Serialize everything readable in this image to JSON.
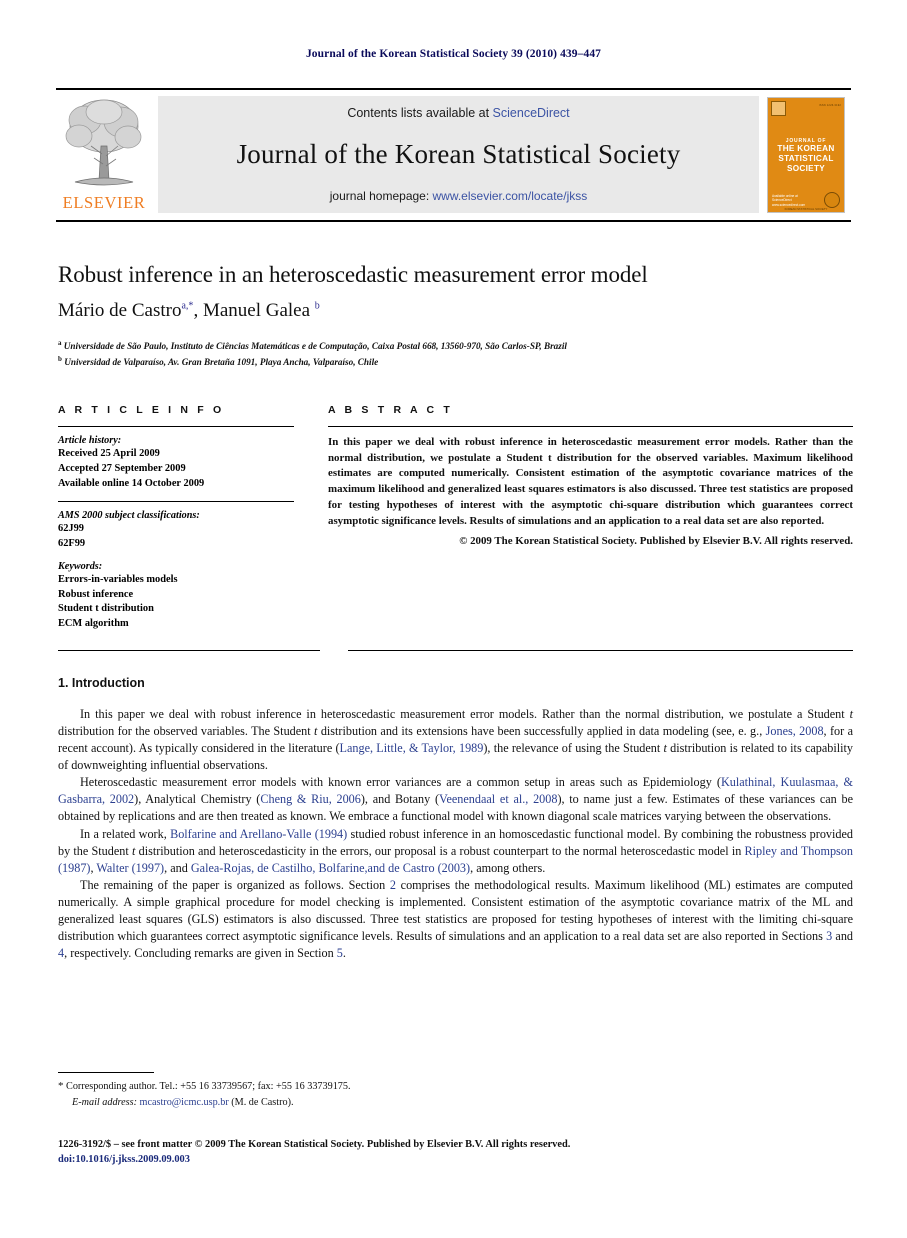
{
  "running_head": "Journal of the Korean Statistical Society 39 (2010) 439–447",
  "masthead": {
    "contents_prefix": "Contents lists available at ",
    "sciencedirect": "ScienceDirect",
    "journal_title": "Journal of the Korean Statistical Society",
    "homepage_prefix": "journal homepage: ",
    "homepage_url": "www.elsevier.com/locate/jkss",
    "publisher_logo_word": "ELSEVIER",
    "cover": {
      "line1": "JOURNAL OF",
      "line2": "THE KOREAN",
      "line3": "STATISTICAL",
      "line4": "SOCIETY",
      "availability": "Available online at",
      "platform": "ScienceDirect",
      "platform_url": "www.sciencedirect.com",
      "society_line": "KOREAN STATISTICAL SOCIETY",
      "top_left_label": "ISSN 1226-3192",
      "top_right_label": "ISSN 1226-3192"
    },
    "accent_color": "#ef7d22",
    "link_color": "#3b53a4",
    "cover_color": "#e08a14"
  },
  "article": {
    "title": "Robust inference in an heteroscedastic measurement error model",
    "authors_part1": "Mário de Castro",
    "authors_sup1": "a,*",
    "authors_part2": ", Manuel Galea ",
    "authors_sup2": "b",
    "affiliation_a_sup": "a",
    "affiliation_a": "Universidade de São Paulo, Instituto de Ciências Matemáticas e de Computação, Caixa Postal 668, 13560-970, São Carlos-SP, Brazil",
    "affiliation_b_sup": "b",
    "affiliation_b": "Universidad de Valparaíso, Av. Gran Bretaña 1091, Playa Ancha, Valparaíso, Chile"
  },
  "article_info": {
    "heading": "A R T I C L E    I N F O",
    "history_label": "Article history:",
    "history": [
      "Received 25 April 2009",
      "Accepted 27 September 2009",
      "Available online 14 October 2009"
    ],
    "ams_label": "AMS 2000 subject classifications:",
    "ams": [
      "62J99",
      "62F99"
    ],
    "keywords_label": "Keywords:",
    "keywords": [
      "Errors-in-variables models",
      "Robust inference",
      "Student t distribution",
      "ECM algorithm"
    ]
  },
  "abstract": {
    "heading": "A B S T R A C T",
    "text": "In this paper we deal with robust inference in heteroscedastic measurement error models. Rather than the normal distribution, we postulate a Student t distribution for the observed variables. Maximum likelihood estimates are computed numerically. Consistent estimation of the asymptotic covariance matrices of the maximum likelihood and generalized least squares estimators is also discussed. Three test statistics are proposed for testing hypotheses of interest with the asymptotic chi-square distribution which guarantees correct asymptotic significance levels. Results of simulations and an application to a real data set are also reported.",
    "copyright": "© 2009 The Korean Statistical Society. Published by Elsevier B.V. All rights reserved."
  },
  "introduction": {
    "heading": "1. Introduction",
    "p1_a": "In this paper we deal with robust inference in heteroscedastic measurement error models. Rather than the normal distribution, we postulate a Student ",
    "p1_b": " distribution for the observed variables. The Student ",
    "p1_c": " distribution and its extensions have been successfully applied in data modeling (see, e. g., ",
    "p1_cite1": "Jones, 2008",
    "p1_d": ", for a recent account). As typically considered in the literature (",
    "p1_cite2": "Lange, Little, & Taylor, 1989",
    "p1_e": "), the relevance of using the Student ",
    "p1_f": " distribution is related to its capability of downweighting influential observations.",
    "p2_a": "Heteroscedastic measurement error models with known error variances are a common setup in areas such as Epidemiology (",
    "p2_cite1": "Kulathinal, Kuulasmaa, & Gasbarra, 2002",
    "p2_b": "), Analytical Chemistry (",
    "p2_cite2": "Cheng & Riu, 2006",
    "p2_c": "), and Botany (",
    "p2_cite3": "Veenendaal et al., 2008",
    "p2_d": "), to name just a few. Estimates of these variances can be obtained by replications and are then treated as known. We embrace a functional model with known diagonal scale matrices varying between the observations.",
    "p3_a": "In a related work, ",
    "p3_cite1": "Bolfarine and Arellano-Valle",
    "p3_cite1b": " (1994)",
    "p3_b": " studied robust inference in an homoscedastic functional model. By combining the robustness provided by the Student ",
    "p3_c": " distribution and heteroscedasticity in the errors, our proposal is a robust counterpart to the normal heteroscedastic model in ",
    "p3_cite2": "Ripley and Thompson",
    "p3_cite2b": " (1987)",
    "p3_d": ", ",
    "p3_cite3": "Walter",
    "p3_cite3b": " (1997)",
    "p3_e": ", and ",
    "p3_cite4": "Galea-Rojas, de Castilho, Bolfarine,and de Castro",
    "p3_cite4b": " (2003)",
    "p3_f": ", among others.",
    "p4_a": "The remaining of the paper is organized as follows. Section ",
    "p4_ref1": "2",
    "p4_b": " comprises the methodological results. Maximum likelihood (ML) estimates are computed numerically. A simple graphical procedure for model checking is implemented. Consistent estimation of the asymptotic covariance matrix of the ML and generalized least squares (GLS) estimators is also discussed. Three test statistics are proposed for testing hypotheses of interest with the limiting chi-square distribution which guarantees correct asymptotic significance levels. Results of simulations and an application to a real data set are also reported in Sections ",
    "p4_ref2": "3",
    "p4_c": " and ",
    "p4_ref3": "4",
    "p4_d": ", respectively. Concluding remarks are given in Section ",
    "p4_ref4": "5",
    "p4_e": "."
  },
  "footnotes": {
    "corresponding": "Corresponding author. Tel.: +55 16 33739567; fax: +55 16 33739175.",
    "email_label": "E-mail address:",
    "email": "mcastro@icmc.usp.br",
    "email_suffix": "(M. de Castro).",
    "front_matter": "1226-3192/$ – see front matter © 2009 The Korean Statistical Society. Published by Elsevier B.V. All rights reserved.",
    "doi": "doi:10.1016/j.jkss.2009.09.003"
  }
}
